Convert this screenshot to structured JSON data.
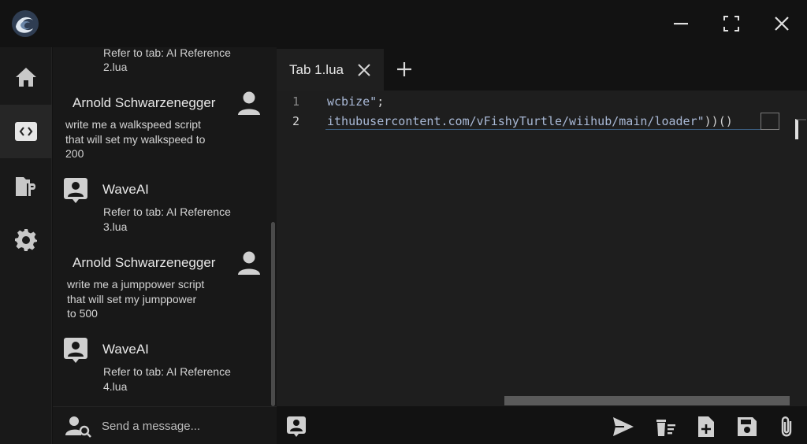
{
  "colors": {
    "background": "#121212",
    "panel": "#181818",
    "editor": "#1e1e1e",
    "accent_string": "#a9b9d6",
    "text": "#e0e0e0"
  },
  "window": {
    "logo_icon": "wave-logo-icon",
    "controls": [
      "minimize-icon",
      "maximize-icon",
      "close-icon"
    ]
  },
  "nav": {
    "items": [
      {
        "name": "home",
        "icon": "home-icon"
      },
      {
        "name": "editor",
        "icon": "code-icon",
        "active": true
      },
      {
        "name": "script-hub",
        "icon": "script-folder-icon"
      },
      {
        "name": "settings",
        "icon": "gear-icon"
      }
    ]
  },
  "chat": {
    "partial_top": {
      "line1": "Refer to tab: AI Reference",
      "line2": "2.lua"
    },
    "messages": [
      {
        "role": "user",
        "name": "Arnold Schwarzenegger",
        "lines": [
          "write me a walkspeed script",
          "that will set my walkspeed to",
          "200"
        ]
      },
      {
        "role": "ai",
        "name": "WaveAI",
        "lines": [
          "Refer to tab: AI Reference",
          "3.lua"
        ]
      },
      {
        "role": "user",
        "name": "Arnold Schwarzenegger",
        "lines": [
          "write me a jumppower script",
          "that will set my jumppower",
          "to 500"
        ]
      },
      {
        "role": "ai",
        "name": "WaveAI",
        "lines": [
          "Refer to tab: AI Reference",
          "4.lua"
        ]
      }
    ],
    "input_placeholder": "Send a message..."
  },
  "editor": {
    "tab_label": "Tab 1.lua",
    "line_numbers": [
      "1",
      "2"
    ],
    "code": {
      "line1_string": "wcbize\"",
      "line1_end": ";",
      "line2_string": "ithubusercontent.com/vFishyTurtle/wiihub/main/loader\"",
      "line2_end": "))()"
    }
  },
  "toolbar": {
    "buttons": [
      "ai-assistant-icon",
      "send-icon",
      "clear-icon",
      "new-file-icon",
      "save-icon",
      "attach-icon"
    ]
  }
}
